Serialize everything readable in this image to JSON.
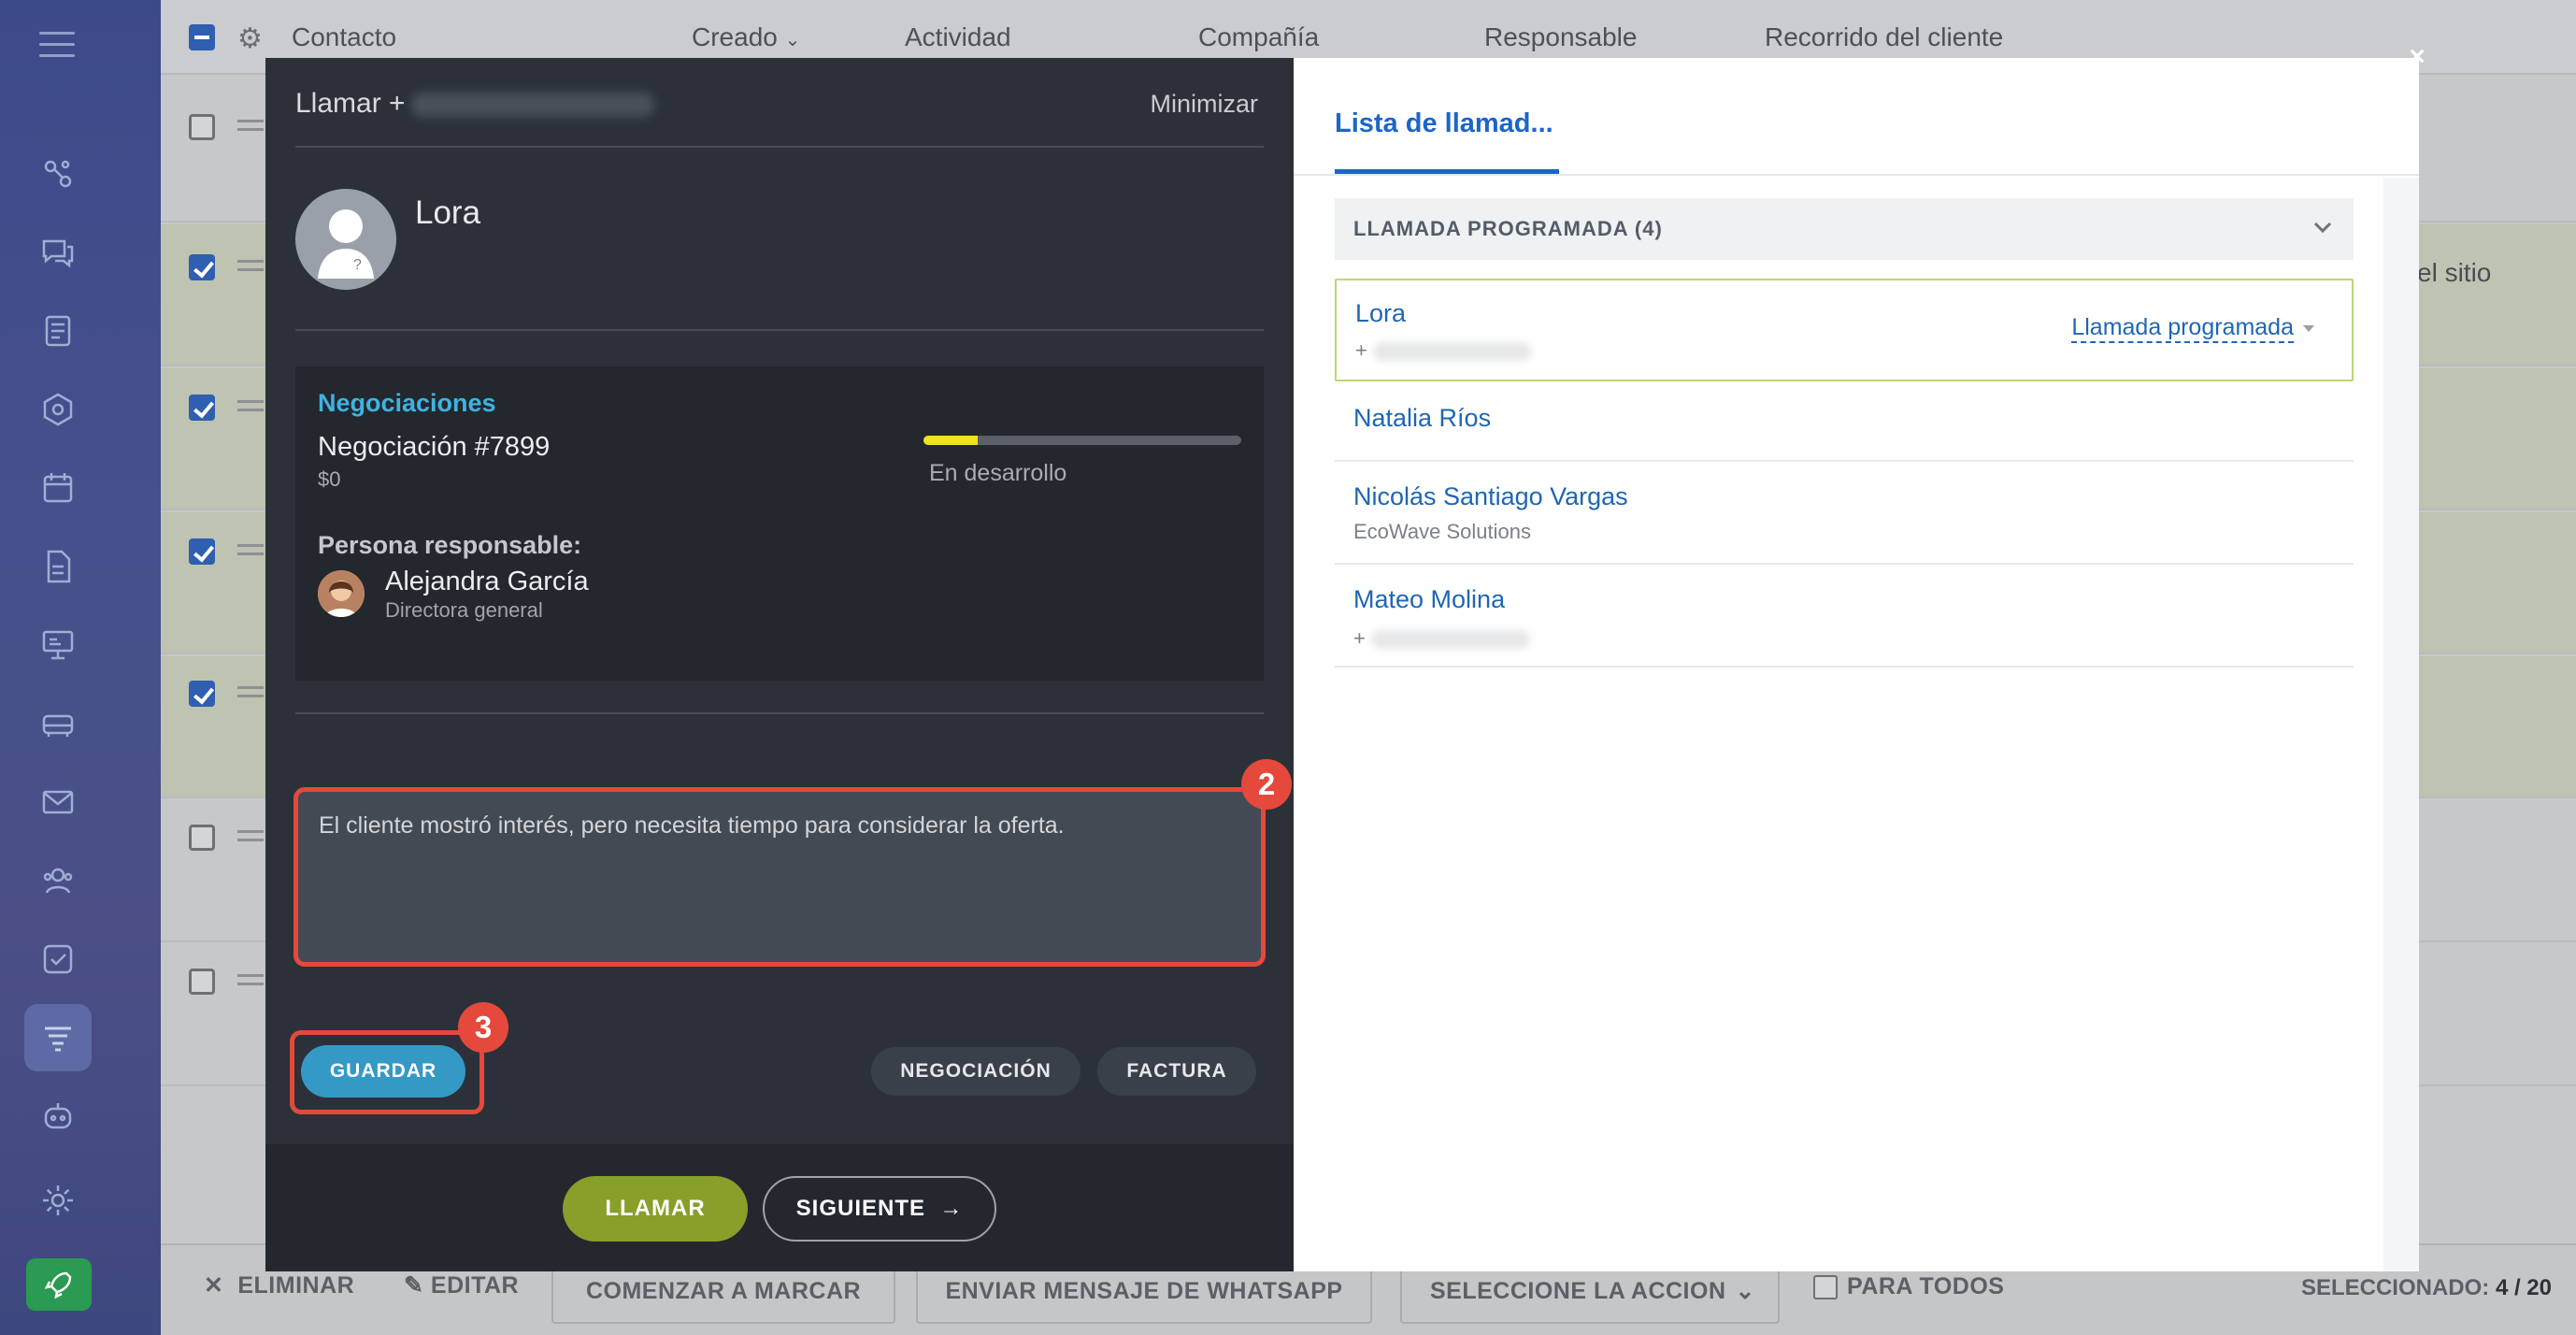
{
  "crm": {
    "columns": [
      "Contacto",
      "Creado",
      "Actividad",
      "Compañía",
      "Responsable",
      "Recorrido del cliente"
    ],
    "row_snippet": "el sitio",
    "footer": {
      "delete": "ELIMINAR",
      "edit": "EDITAR",
      "start_dialing": "COMENZAR A MARCAR",
      "whatsapp": "ENVIAR MENSAJE DE WHATSAPP",
      "select_action": "SELECCIONE LA ACCION",
      "for_all": "PARA TODOS",
      "selected_label": "SELECCIONADO:",
      "selected_value": "4 / 20"
    }
  },
  "call": {
    "title": "Llamar +",
    "minimize": "Minimizar",
    "contact_name": "Lora",
    "deals_heading": "Negociaciones",
    "deal_name": "Negociación #7899",
    "deal_amount": "$0",
    "deal_progress": 0.17,
    "deal_stage": "En desarrollo",
    "responsible_heading": "Persona responsable:",
    "responsible_name": "Alejandra García",
    "responsible_role": "Directora general",
    "comment": "El cliente mostró interés, pero necesita tiempo para considerar la oferta.",
    "save": "GUARDAR",
    "deal_button": "NEGOCIACIÓN",
    "invoice_button": "FACTURA",
    "call_button": "LLAMAR",
    "next_button": "SIGUIENTE",
    "badge_comment": "2",
    "badge_save": "3"
  },
  "call_list": {
    "tab": "Lista de llamad...",
    "group": "LLAMADA PROGRAMADA (4)",
    "items": [
      {
        "name": "Lora",
        "sub": "+",
        "status": "Llamada programada"
      },
      {
        "name": "Natalia Ríos",
        "sub": ""
      },
      {
        "name": "Nicolás Santiago Vargas",
        "sub": "EcoWave Solutions"
      },
      {
        "name": "Mateo Molina",
        "sub": "+"
      }
    ]
  },
  "close": "×"
}
